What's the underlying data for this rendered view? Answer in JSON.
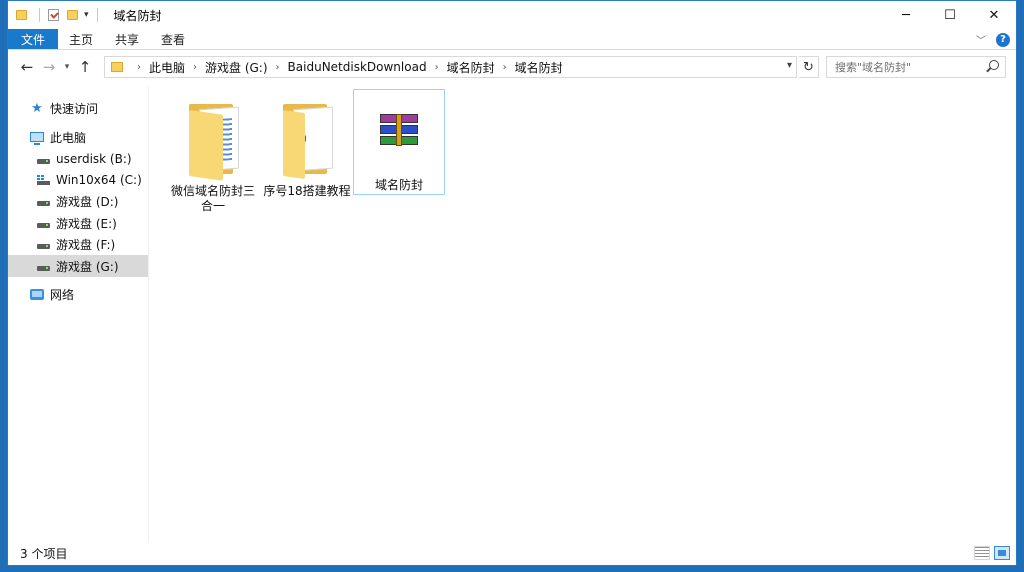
{
  "window": {
    "title": "域名防封",
    "controls": {
      "minimize": "─",
      "maximize": "☐",
      "close": "✕"
    }
  },
  "ribbon": {
    "tabs": [
      "文件",
      "主页",
      "共享",
      "查看"
    ],
    "help": "?"
  },
  "address": {
    "path": [
      "此电脑",
      "游戏盘 (G:)",
      "BaiduNetdiskDownload",
      "域名防封",
      "域名防封"
    ],
    "search_placeholder": "搜索\"域名防封\""
  },
  "nav": {
    "items": [
      {
        "label": "快速访问",
        "icon": "star-icon"
      },
      {
        "label": "此电脑",
        "icon": "computer-icon"
      },
      {
        "label": "userdisk (B:)",
        "icon": "drive-icon"
      },
      {
        "label": "Win10x64 (C:)",
        "icon": "windows-drive-icon"
      },
      {
        "label": "游戏盘 (D:)",
        "icon": "drive-icon"
      },
      {
        "label": "游戏盘 (E:)",
        "icon": "drive-icon"
      },
      {
        "label": "游戏盘 (F:)",
        "icon": "drive-icon"
      },
      {
        "label": "游戏盘 (G:)",
        "icon": "drive-icon",
        "selected": true
      },
      {
        "label": "网络",
        "icon": "network-icon"
      }
    ]
  },
  "files": [
    {
      "name": "微信域名防封三合一",
      "type": "folder",
      "icon": "folder-icon"
    },
    {
      "name": "序号18搭建教程",
      "type": "folder",
      "icon": "folder-icon"
    },
    {
      "name": "域名防封",
      "type": "rar",
      "icon": "winrar-archive-icon",
      "selected": true
    }
  ],
  "status": {
    "count_text": "3 个项目"
  }
}
